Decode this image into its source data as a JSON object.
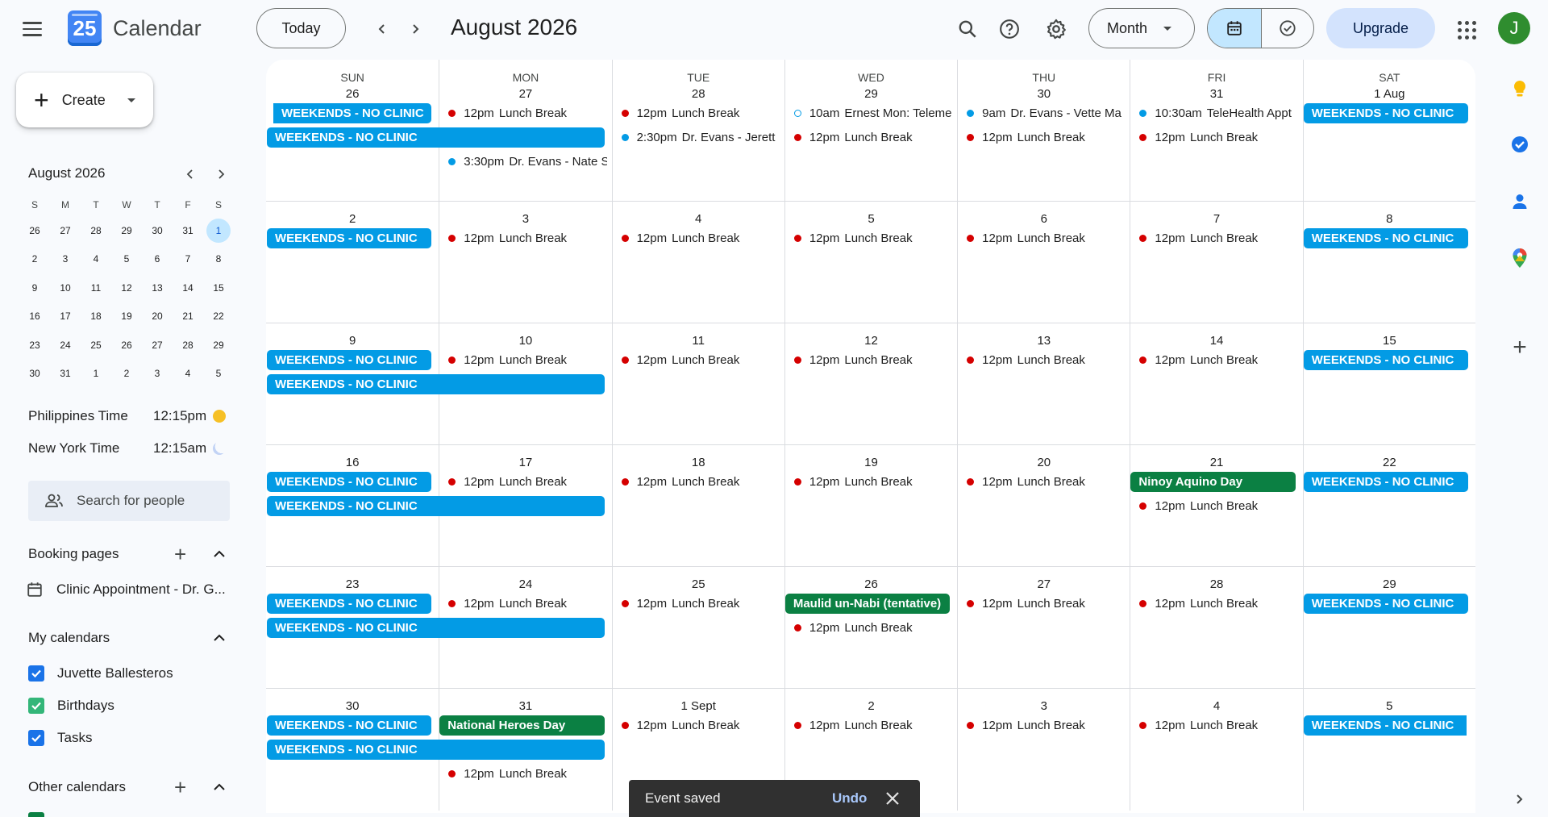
{
  "app": {
    "title": "Calendar",
    "logo_day": "25",
    "period": "August 2026"
  },
  "header": {
    "today": "Today",
    "view": "Month",
    "upgrade": "Upgrade",
    "avatar_letter": "J"
  },
  "sidebar": {
    "create": "Create",
    "mini": {
      "title": "August 2026",
      "dows": [
        "S",
        "M",
        "T",
        "W",
        "T",
        "F",
        "S"
      ],
      "days": [
        "26",
        "27",
        "28",
        "29",
        "30",
        "31",
        "1",
        "2",
        "3",
        "4",
        "5",
        "6",
        "7",
        "8",
        "9",
        "10",
        "11",
        "12",
        "13",
        "14",
        "15",
        "16",
        "17",
        "18",
        "19",
        "20",
        "21",
        "22",
        "23",
        "24",
        "25",
        "26",
        "27",
        "28",
        "29",
        "30",
        "31",
        "1",
        "2",
        "3",
        "4",
        "5"
      ]
    },
    "timezones": [
      {
        "label": "Philippines Time",
        "time": "12:15pm"
      },
      {
        "label": "New York Time",
        "time": "12:15am"
      }
    ],
    "search_people": "Search for people",
    "booking_title": "Booking pages",
    "booking_item": "Clinic Appointment - Dr. G...",
    "my_calendars_title": "My calendars",
    "my_calendars": [
      {
        "label": "Juvette Ballesteros",
        "color": "#1a73e8"
      },
      {
        "label": "Birthdays",
        "color": "#33b679"
      },
      {
        "label": "Tasks",
        "color": "#1a73e8"
      }
    ],
    "other_calendars_title": "Other calendars"
  },
  "grid": {
    "dows": [
      "SUN",
      "MON",
      "TUE",
      "WED",
      "THU",
      "FRI",
      "SAT"
    ],
    "weeks": [
      {
        "dates": [
          "26",
          "27",
          "28",
          "29",
          "30",
          "31",
          "1 Aug"
        ]
      },
      {
        "dates": [
          "2",
          "3",
          "4",
          "5",
          "6",
          "7",
          "8"
        ]
      },
      {
        "dates": [
          "9",
          "10",
          "11",
          "12",
          "13",
          "14",
          "15"
        ]
      },
      {
        "dates": [
          "16",
          "17",
          "18",
          "19",
          "20",
          "21",
          "22"
        ]
      },
      {
        "dates": [
          "23",
          "24",
          "25",
          "26",
          "27",
          "28",
          "29"
        ]
      },
      {
        "dates": [
          "30",
          "31",
          "1 Sept",
          "2",
          "3",
          "4",
          "5"
        ]
      }
    ],
    "weekend_label": "WEEKENDS - NO CLINIC",
    "lunch_time": "12pm",
    "lunch_name": "Lunch Break",
    "events": {
      "w0_mon_2": {
        "time": "3:30pm",
        "name": "Dr. Evans - Nate S"
      },
      "w0_tue_1": {
        "time": "2:30pm",
        "name": "Dr. Evans - Jerett"
      },
      "w0_wed_0": {
        "time": "10am",
        "name": "Ernest Mon: Teleme"
      },
      "w0_thu_0": {
        "time": "9am",
        "name": "Dr. Evans - Vette Ma"
      },
      "w0_fri_0": {
        "time": "10:30am",
        "name": "TeleHealth Appt"
      },
      "ninoy": "Ninoy Aquino Day",
      "maulid": "Maulid un-Nabi (tentative)",
      "heroes": "National Heroes Day"
    }
  },
  "toast": {
    "message": "Event saved",
    "action": "Undo"
  }
}
